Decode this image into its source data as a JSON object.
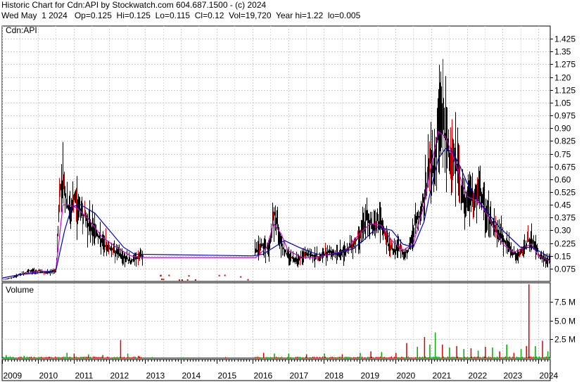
{
  "header": {
    "line1": "Historic Chart for Cdn:API by Stockwatch.com 604.687.1500 - (c) 2024",
    "line2": "Wed May  1 2024   Op=0.125  Hi=0.125  Lo=0.115  Cl=0.12  Vol=19,720  Year hi=1.22  lo=0.005"
  },
  "colors": {
    "price_bar": "#000000",
    "up_bar": "#dd0000",
    "ma_short": "#cc00cc",
    "ma_long": "#0000cc",
    "vol_up": "#00aa00",
    "vol_down": "#dd0000",
    "grid": "#cccccc",
    "axis": "#000000"
  },
  "chart_data": [
    {
      "type": "line",
      "label": "Cdn:API",
      "xlim": [
        2009,
        2024.33
      ],
      "ylim": [
        0,
        1.5
      ],
      "grid": true,
      "y_ticks": [
        "1.425",
        "1.35",
        "1.275",
        "1.20",
        "1.125",
        "1.05",
        "0.975",
        "0.90",
        "0.825",
        "0.75",
        "0.675",
        "0.60",
        "0.525",
        "0.45",
        "0.375",
        "0.30",
        "0.225",
        "0.15",
        "0.075"
      ],
      "x_ticks": [
        "2009",
        "2010",
        "2011",
        "2012",
        "2013",
        "2014",
        "2015",
        "2016",
        "2017",
        "2018",
        "2019",
        "2020",
        "2021",
        "2022",
        "2023",
        "2024"
      ],
      "series": [
        {
          "style": "price",
          "x": [
            2009.0,
            2009.25,
            2009.5,
            2009.75,
            2010.0,
            2010.25,
            2010.5,
            2010.6,
            2010.7,
            2010.8,
            2010.9,
            2011.0,
            2011.1,
            2011.25,
            2011.4,
            2011.6,
            2011.8,
            2012.0,
            2012.2,
            2012.4,
            2012.6,
            2012.9,
            2016.1,
            2016.2,
            2016.3,
            2016.45,
            2016.6,
            2016.75,
            2016.85,
            2016.95,
            2017.1,
            2017.3,
            2017.5,
            2017.7,
            2017.9,
            2018.1,
            2018.3,
            2018.5,
            2018.7,
            2018.9,
            2019.05,
            2019.2,
            2019.35,
            2019.5,
            2019.65,
            2019.8,
            2019.95,
            2020.1,
            2020.25,
            2020.4,
            2020.55,
            2020.7,
            2020.85,
            2020.95,
            2021.05,
            2021.15,
            2021.25,
            2021.35,
            2021.45,
            2021.55,
            2021.65,
            2021.75,
            2021.85,
            2021.95,
            2022.05,
            2022.15,
            2022.25,
            2022.35,
            2022.5,
            2022.65,
            2022.8,
            2022.95,
            2023.1,
            2023.25,
            2023.4,
            2023.55,
            2023.7,
            2023.85,
            2024.0,
            2024.15,
            2024.33
          ],
          "y": [
            0.01,
            0.02,
            0.04,
            0.06,
            0.06,
            0.05,
            0.06,
            0.52,
            0.62,
            0.45,
            0.4,
            0.48,
            0.44,
            0.4,
            0.34,
            0.3,
            0.22,
            0.2,
            0.17,
            0.14,
            0.12,
            0.15,
            0.18,
            0.2,
            0.22,
            0.18,
            0.4,
            0.28,
            0.2,
            0.16,
            0.14,
            0.13,
            0.16,
            0.15,
            0.14,
            0.18,
            0.16,
            0.17,
            0.2,
            0.24,
            0.3,
            0.37,
            0.33,
            0.36,
            0.3,
            0.22,
            0.18,
            0.2,
            0.16,
            0.2,
            0.35,
            0.4,
            0.55,
            0.7,
            0.68,
            0.8,
            1.05,
            0.9,
            0.78,
            0.74,
            0.72,
            0.65,
            0.52,
            0.42,
            0.55,
            0.46,
            0.5,
            0.52,
            0.42,
            0.37,
            0.3,
            0.27,
            0.22,
            0.18,
            0.14,
            0.18,
            0.24,
            0.23,
            0.16,
            0.13,
            0.12
          ]
        },
        {
          "style": "ma_short",
          "x": [
            2009.0,
            2009.5,
            2010.0,
            2010.5,
            2010.7,
            2010.9,
            2011.1,
            2011.4,
            2011.8,
            2012.2,
            2012.6,
            2012.9,
            2016.1,
            2016.4,
            2016.6,
            2016.8,
            2017.0,
            2017.4,
            2017.8,
            2018.2,
            2018.6,
            2019.0,
            2019.3,
            2019.6,
            2019.9,
            2020.2,
            2020.5,
            2020.8,
            2021.0,
            2021.2,
            2021.4,
            2021.6,
            2021.8,
            2022.0,
            2022.2,
            2022.4,
            2022.6,
            2022.8,
            2023.0,
            2023.3,
            2023.6,
            2023.8,
            2024.0,
            2024.33
          ],
          "y": [
            0.02,
            0.04,
            0.06,
            0.06,
            0.45,
            0.45,
            0.43,
            0.37,
            0.26,
            0.2,
            0.15,
            0.14,
            0.14,
            0.2,
            0.34,
            0.28,
            0.18,
            0.14,
            0.14,
            0.16,
            0.18,
            0.28,
            0.34,
            0.33,
            0.24,
            0.18,
            0.22,
            0.45,
            0.68,
            0.88,
            0.85,
            0.74,
            0.62,
            0.5,
            0.48,
            0.45,
            0.38,
            0.3,
            0.22,
            0.17,
            0.2,
            0.22,
            0.15,
            0.12
          ]
        },
        {
          "style": "ma_long",
          "x": [
            2009.0,
            2009.5,
            2010.0,
            2010.5,
            2010.75,
            2010.95,
            2011.2,
            2011.6,
            2012.0,
            2012.4,
            2012.7,
            2016.0,
            2016.3,
            2016.6,
            2016.9,
            2017.3,
            2017.8,
            2018.3,
            2018.8,
            2019.1,
            2019.5,
            2019.9,
            2020.2,
            2020.5,
            2020.8,
            2021.0,
            2021.2,
            2021.4,
            2021.6,
            2021.8,
            2022.0,
            2022.3,
            2022.6,
            2022.9,
            2023.2,
            2023.5,
            2023.8,
            2024.0,
            2024.33
          ],
          "y": [
            0.02,
            0.04,
            0.05,
            0.06,
            0.3,
            0.44,
            0.45,
            0.4,
            0.3,
            0.2,
            0.16,
            0.15,
            0.16,
            0.2,
            0.24,
            0.2,
            0.16,
            0.16,
            0.19,
            0.24,
            0.32,
            0.3,
            0.22,
            0.2,
            0.35,
            0.55,
            0.72,
            0.78,
            0.76,
            0.68,
            0.58,
            0.48,
            0.4,
            0.32,
            0.26,
            0.2,
            0.2,
            0.18,
            0.14
          ]
        }
      ]
    },
    {
      "type": "bar",
      "label": "Volume",
      "xlim": [
        2009,
        2024.33
      ],
      "ylim": [
        0,
        10000000
      ],
      "y_ticks": [
        "7.5 M",
        "5.0 M",
        "2.5 M"
      ],
      "x": [
        2009.1,
        2009.6,
        2010.3,
        2010.8,
        2011.0,
        2011.4,
        2011.8,
        2012.3,
        2012.5,
        2012.8,
        2016.3,
        2016.6,
        2017.0,
        2017.5,
        2018.0,
        2018.5,
        2019.0,
        2019.3,
        2019.6,
        2020.0,
        2020.3,
        2020.6,
        2020.8,
        2020.95,
        2021.1,
        2021.3,
        2021.5,
        2021.7,
        2021.9,
        2022.1,
        2022.3,
        2022.5,
        2022.7,
        2022.9,
        2023.1,
        2023.3,
        2023.5,
        2023.65,
        2023.72,
        2023.9,
        2024.1,
        2024.25
      ],
      "values": [
        400000,
        300000,
        200000,
        700000,
        600000,
        500000,
        400000,
        2400000,
        600000,
        300000,
        700000,
        600000,
        600000,
        500000,
        600000,
        500000,
        700000,
        900000,
        800000,
        700000,
        2000000,
        1500000,
        2800000,
        1800000,
        3400000,
        1800000,
        1400000,
        1600000,
        1200000,
        1300000,
        1000000,
        1500000,
        1400000,
        900000,
        1800000,
        700000,
        1200000,
        1600000,
        9800000,
        1600000,
        2300000,
        900000
      ],
      "up": [
        true,
        true,
        false,
        true,
        false,
        true,
        false,
        false,
        true,
        false,
        false,
        true,
        true,
        false,
        true,
        false,
        true,
        false,
        true,
        false,
        false,
        true,
        false,
        true,
        true,
        false,
        true,
        false,
        true,
        false,
        true,
        false,
        true,
        false,
        true,
        false,
        true,
        false,
        false,
        true,
        false,
        true
      ]
    }
  ]
}
